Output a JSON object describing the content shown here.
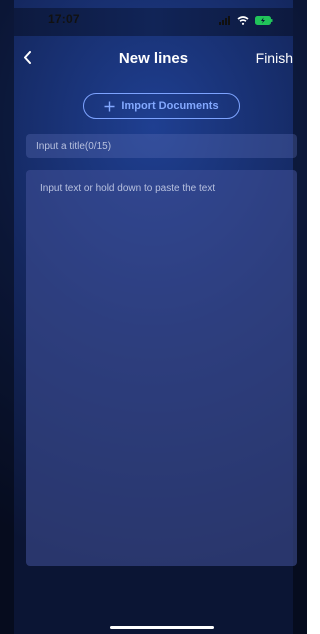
{
  "status_bar": {
    "time": "17:07",
    "icons": [
      "signal-icon",
      "wifi-icon",
      "battery-charging-icon"
    ]
  },
  "nav": {
    "title": "New lines",
    "finish_label": "Finish",
    "back_icon": "chevron-left-icon"
  },
  "import": {
    "label": "Import Documents",
    "icon": "plus-icon"
  },
  "title_field": {
    "placeholder": "Input a title(0/15)"
  },
  "text_field": {
    "placeholder": "Input text or hold down to paste the text"
  },
  "colors": {
    "accent": "#84a9ff",
    "background": "#14275e",
    "panel": "#404f96"
  }
}
